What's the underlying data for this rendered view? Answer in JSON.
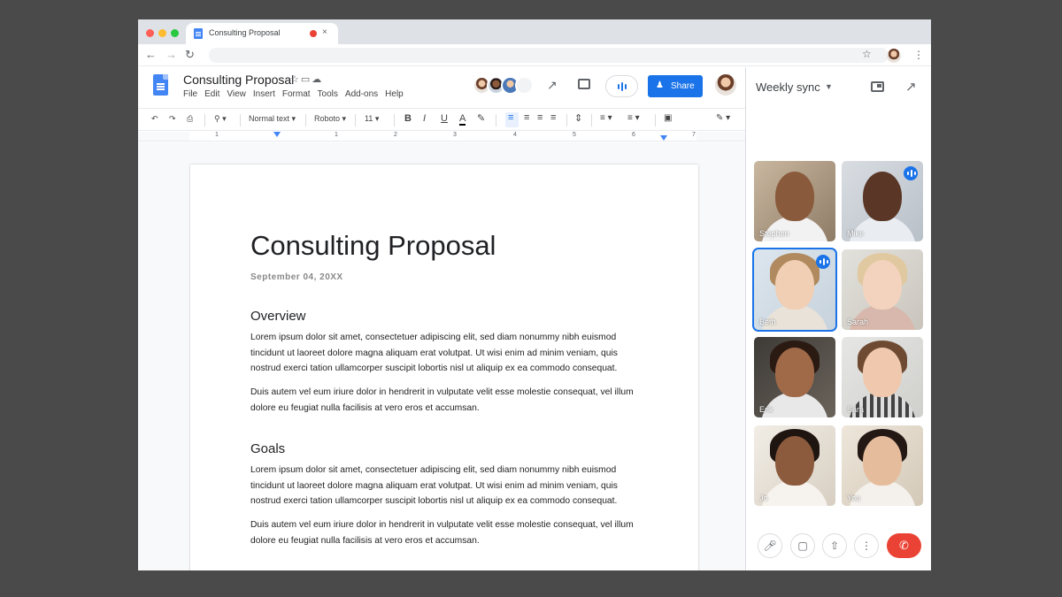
{
  "browser": {
    "tab_title": "Consulting Proposal",
    "tab_close": "×",
    "icons": [
      "back-icon",
      "forward-icon",
      "reload-icon",
      "star-icon",
      "more-vert-icon"
    ]
  },
  "docs": {
    "title": "Consulting Proposal",
    "menu": [
      "File",
      "Edit",
      "View",
      "Insert",
      "Format",
      "Tools",
      "Add-ons",
      "Help"
    ],
    "share_label": "Share",
    "toolbar": {
      "style": "Normal text",
      "font": "Roboto",
      "size": "11"
    },
    "ruler_numbers": [
      "1",
      "1",
      "2",
      "3",
      "4",
      "5",
      "6",
      "7"
    ]
  },
  "document": {
    "heading": "Consulting Proposal",
    "date": "September 04, 20XX",
    "sections": [
      {
        "title": "Overview",
        "paragraphs": [
          "Lorem ipsum dolor sit amet, consectetuer adipiscing elit, sed diam nonummy nibh euismod tincidunt ut laoreet dolore magna aliquam erat volutpat. Ut wisi enim ad minim veniam, quis nostrud exerci tation ullamcorper suscipit lobortis nisl ut aliquip ex ea commodo consequat.",
          "Duis autem vel eum iriure dolor in hendrerit in vulputate velit esse molestie consequat, vel illum dolore eu feugiat nulla facilisis at vero eros et accumsan."
        ]
      },
      {
        "title": "Goals",
        "paragraphs": [
          "Lorem ipsum dolor sit amet, consectetuer adipiscing elit, sed diam nonummy nibh euismod tincidunt ut laoreet dolore magna aliquam erat volutpat. Ut wisi enim ad minim veniam, quis nostrud exerci tation ullamcorper suscipit lobortis nisl ut aliquip ex ea commodo consequat.",
          "Duis autem vel eum iriure dolor in hendrerit in vulputate velit esse molestie consequat, vel illum dolore eu feugiat nulla facilisis at vero eros et accumsan."
        ]
      }
    ]
  },
  "meet": {
    "meeting_title": "Weekly sync",
    "participants": [
      {
        "name": "Stephen",
        "speaking": false
      },
      {
        "name": "Mike",
        "speaking": true
      },
      {
        "name": "Beth",
        "speaking": true
      },
      {
        "name": "Sarah",
        "speaking": false
      },
      {
        "name": "Erik",
        "speaking": false
      },
      {
        "name": "Sara",
        "speaking": false
      },
      {
        "name": "Jo",
        "speaking": false
      },
      {
        "name": "You",
        "speaking": false
      }
    ],
    "controls": [
      "mic-icon",
      "camera-icon",
      "present-icon",
      "more-vert-icon",
      "hangup-icon"
    ]
  },
  "colors": {
    "accent": "#1a73e8",
    "hangup": "#ea4335",
    "backdrop": "#4a4a4a"
  }
}
